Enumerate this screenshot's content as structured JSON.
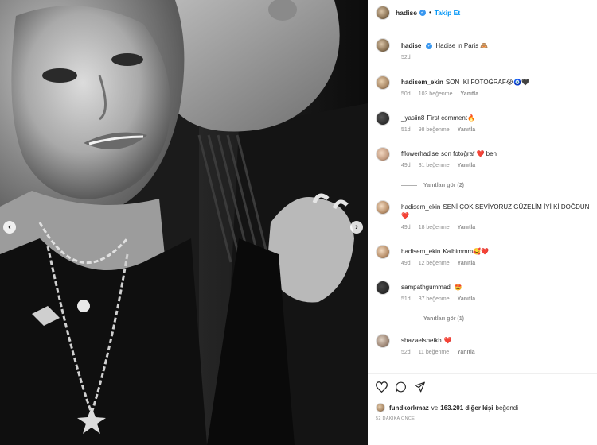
{
  "post_header": {
    "username": "hadise",
    "verified_icon": "verified-badge-icon",
    "separator": "•",
    "follow_label": "Takip Et"
  },
  "caption": {
    "username": "hadise",
    "text": "Hadise in Paris 🙈",
    "time": "52d"
  },
  "comments": [
    {
      "username": "hadisem_ekin",
      "text": "SON İKİ FOTOĞRAF😭🧿🖤",
      "time": "50d",
      "likes": "103 beğenme",
      "reply": "Yanıtla"
    },
    {
      "username": "_yasiin8",
      "text": "First comment🔥",
      "time": "51d",
      "likes": "98 beğenme",
      "reply": "Yanıtla"
    },
    {
      "username": "fflowerhadise",
      "text": "son fotoğraf ❤️ ben",
      "time": "49d",
      "likes": "31 beğenme",
      "reply": "Yanıtla",
      "view_replies": "Yanıtları gör (2)"
    },
    {
      "username": "hadisem_ekin",
      "text": "SENİ ÇOK SEVİYORUZ GÜZELİM İYİ Kİ DOĞDUN ❤️",
      "time": "49d",
      "likes": "18 beğenme",
      "reply": "Yanıtla"
    },
    {
      "username": "hadisem_ekin",
      "text": "Kalbimmm🥰❤️",
      "time": "49d",
      "likes": "12 beğenme",
      "reply": "Yanıtla"
    },
    {
      "username": "sampathgummadi",
      "text": "🤩",
      "time": "51d",
      "likes": "37 beğenme",
      "reply": "Yanıtla",
      "view_replies": "Yanıtları gör (1)"
    },
    {
      "username": "shazaelsheikh",
      "text": "❤️",
      "time": "52d",
      "likes": "11 beğenme",
      "reply": "Yanıtla"
    }
  ],
  "likes_summary": {
    "user": "fundkorkmaz",
    "middle": "ve",
    "others": "163.201 diğer kişi",
    "suffix": "beğendi"
  },
  "time_ago": "52 DAKİKA ÖNCE",
  "icons": {
    "like": "heart-icon",
    "comment": "comment-icon",
    "share": "share-icon",
    "prev": "chevron-left-icon",
    "next": "chevron-right-icon"
  },
  "colors": {
    "link": "#0095f6",
    "verified": "#3897f0",
    "meta": "#8e8e8e"
  }
}
